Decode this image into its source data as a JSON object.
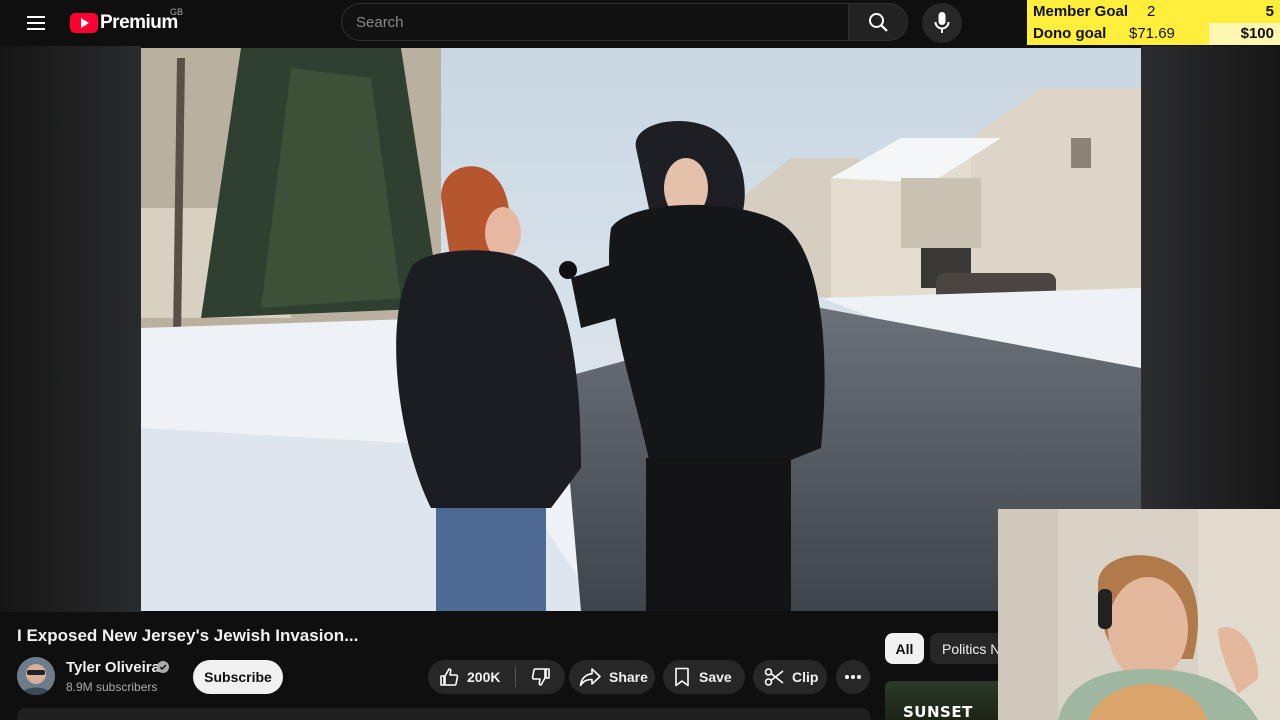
{
  "header": {
    "logo_text": "Premium",
    "logo_region": "GB",
    "search_placeholder": "Search"
  },
  "overlay_goals": {
    "member_goal": {
      "label": "Member Goal",
      "current": "2",
      "target": "5"
    },
    "dono_goal": {
      "label": "Dono goal",
      "current": "$71.69",
      "target": "$100"
    }
  },
  "video": {
    "title": "I Exposed New Jersey's Jewish Invasion...",
    "channel": {
      "name": "Tyler Oliveira",
      "subscribers": "8.9M subscribers"
    },
    "subscribe_label": "Subscribe",
    "actions": {
      "like_count": "200K",
      "share_label": "Share",
      "save_label": "Save",
      "clip_label": "Clip"
    }
  },
  "recommendations": {
    "chips": [
      "All",
      "Politics N"
    ],
    "thumbnail_text": "SUNSET"
  },
  "colors": {
    "background": "#0f0f0f",
    "brand_red": "#ff0033",
    "goal_yellow": "#ffef3c",
    "pill_bg": "#272727"
  },
  "icons": [
    "menu-icon",
    "youtube-logo-icon",
    "search-icon",
    "mic-icon",
    "thumbs-up-icon",
    "thumbs-down-icon",
    "share-icon",
    "bookmark-icon",
    "scissors-icon",
    "more-icon",
    "verified-icon"
  ]
}
